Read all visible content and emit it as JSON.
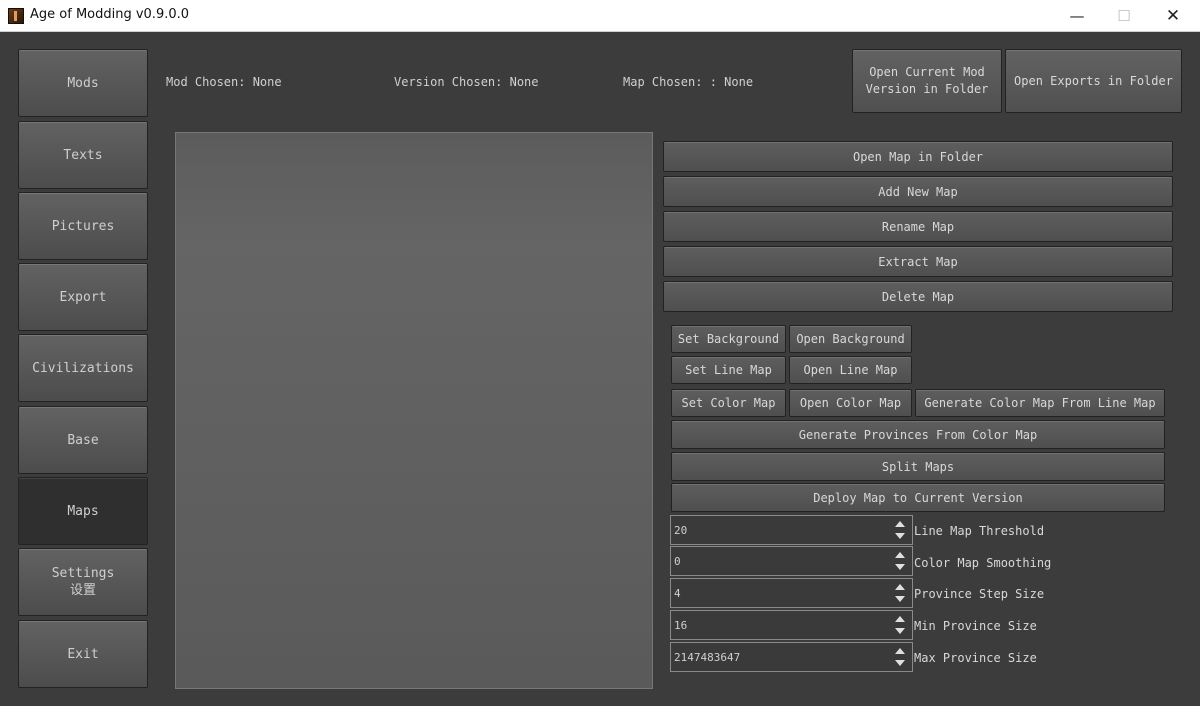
{
  "window": {
    "title": "Age of Modding v0.9.0.0",
    "minimize": "—",
    "maximize": "☐",
    "close": "✕"
  },
  "nav": {
    "mods": "Mods",
    "texts": "Texts",
    "pictures": "Pictures",
    "export": "Export",
    "civilizations": "Civilizations",
    "base": "Base",
    "maps": "Maps",
    "settings": "Settings\n设置",
    "exit": "Exit"
  },
  "info": {
    "mod": "Mod Chosen: None",
    "version": "Version Chosen: None",
    "map": "Map Chosen: : None"
  },
  "top_buttons": {
    "open_mod_version": "Open Current Mod\nVersion in Folder",
    "open_exports": "Open Exports in Folder"
  },
  "map_actions": {
    "open_folder": "Open Map in Folder",
    "add": "Add New Map",
    "rename": "Rename Map",
    "extract": "Extract Map",
    "delete": "Delete Map"
  },
  "map_tools": {
    "set_background": "Set Background",
    "open_background": "Open Background",
    "set_line_map": "Set Line Map",
    "open_line_map": "Open Line Map",
    "set_color_map": "Set Color Map",
    "open_color_map": "Open Color Map",
    "gen_color_from_line": "Generate Color Map From Line Map",
    "gen_provinces": "Generate Provinces From Color Map",
    "split_maps": "Split Maps",
    "deploy": "Deploy Map to Current Version"
  },
  "params": [
    {
      "label": "Line Map Threshold",
      "value": "20"
    },
    {
      "label": "Color Map Smoothing",
      "value": "0"
    },
    {
      "label": "Province Step Size",
      "value": "4"
    },
    {
      "label": "Min Province Size",
      "value": "16"
    },
    {
      "label": "Max Province Size",
      "value": "2147483647"
    }
  ]
}
